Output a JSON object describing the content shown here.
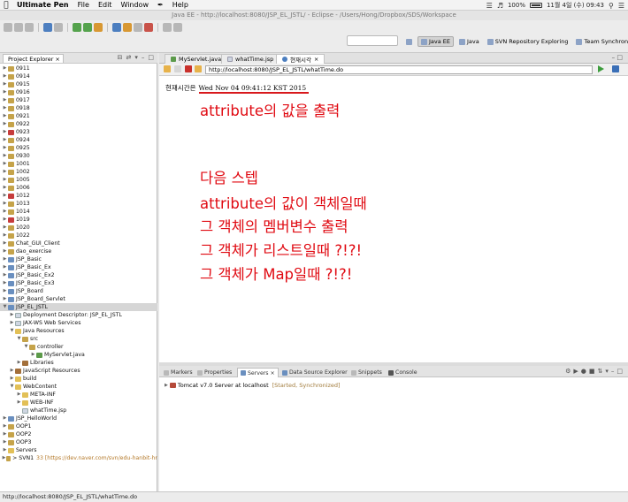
{
  "menubar": {
    "app": "Ultimate Pen",
    "items": [
      "File",
      "Edit",
      "Window",
      "Help"
    ],
    "battery": "100%",
    "datetime": "11월 4일 (수) 09:43"
  },
  "window": {
    "title": "Java EE - http://localhost:8080/JSP_EL_JSTL/ - Eclipse - /Users/Hong/Dropbox/SDS/Workspace"
  },
  "perspectives": [
    "Java EE",
    "Java",
    "SVN Repository Exploring",
    "Team Synchronizing"
  ],
  "explorer": {
    "title": "Project Explorer",
    "items": [
      {
        "label": "0911",
        "depth": 0,
        "icon": "pkg"
      },
      {
        "label": "0914",
        "depth": 0,
        "icon": "pkg"
      },
      {
        "label": "0915",
        "depth": 0,
        "icon": "pkg"
      },
      {
        "label": "0916",
        "depth": 0,
        "icon": "pkg"
      },
      {
        "label": "0917",
        "depth": 0,
        "icon": "pkg"
      },
      {
        "label": "0918",
        "depth": 0,
        "icon": "pkg"
      },
      {
        "label": "0921",
        "depth": 0,
        "icon": "pkg"
      },
      {
        "label": "0922",
        "depth": 0,
        "icon": "pkg"
      },
      {
        "label": "0923",
        "depth": 0,
        "icon": "err"
      },
      {
        "label": "0924",
        "depth": 0,
        "icon": "pkg"
      },
      {
        "label": "0925",
        "depth": 0,
        "icon": "pkg"
      },
      {
        "label": "0930",
        "depth": 0,
        "icon": "pkg"
      },
      {
        "label": "1001",
        "depth": 0,
        "icon": "pkg"
      },
      {
        "label": "1002",
        "depth": 0,
        "icon": "pkg"
      },
      {
        "label": "1005",
        "depth": 0,
        "icon": "pkg"
      },
      {
        "label": "1006",
        "depth": 0,
        "icon": "pkg"
      },
      {
        "label": "1012",
        "depth": 0,
        "icon": "err"
      },
      {
        "label": "1013",
        "depth": 0,
        "icon": "pkg"
      },
      {
        "label": "1014",
        "depth": 0,
        "icon": "pkg"
      },
      {
        "label": "1019",
        "depth": 0,
        "icon": "err"
      },
      {
        "label": "1020",
        "depth": 0,
        "icon": "pkg"
      },
      {
        "label": "1022",
        "depth": 0,
        "icon": "pkg"
      },
      {
        "label": "Chat_GUI_Client",
        "depth": 0,
        "icon": "pkg"
      },
      {
        "label": "dao_exercise",
        "depth": 0,
        "icon": "pkg"
      },
      {
        "label": "JSP_Basic",
        "depth": 0,
        "icon": "proj"
      },
      {
        "label": "JSP_Basic_Ex",
        "depth": 0,
        "icon": "proj"
      },
      {
        "label": "JSP_Basic_Ex2",
        "depth": 0,
        "icon": "proj"
      },
      {
        "label": "JSP_Basic_Ex3",
        "depth": 0,
        "icon": "proj"
      },
      {
        "label": "JSP_Board",
        "depth": 0,
        "icon": "proj"
      },
      {
        "label": "JSP_Board_Servlet",
        "depth": 0,
        "icon": "proj"
      },
      {
        "label": "JSP_EL_JSTL",
        "depth": 0,
        "icon": "proj",
        "open": true,
        "selected": true
      },
      {
        "label": "Deployment Descriptor: JSP_EL_JSTL",
        "depth": 1,
        "icon": "file"
      },
      {
        "label": "JAX-WS Web Services",
        "depth": 1,
        "icon": "file"
      },
      {
        "label": "Java Resources",
        "depth": 1,
        "icon": "folder",
        "open": true
      },
      {
        "label": "src",
        "depth": 2,
        "icon": "pkg",
        "open": true
      },
      {
        "label": "controller",
        "depth": 3,
        "icon": "pkg",
        "open": true
      },
      {
        "label": "MyServlet.java",
        "depth": 4,
        "icon": "java"
      },
      {
        "label": "Libraries",
        "depth": 2,
        "icon": "lib"
      },
      {
        "label": "JavaScript Resources",
        "depth": 1,
        "icon": "lib"
      },
      {
        "label": "build",
        "depth": 1,
        "icon": "folder"
      },
      {
        "label": "WebContent",
        "depth": 1,
        "icon": "folder",
        "open": true
      },
      {
        "label": "META-INF",
        "depth": 2,
        "icon": "folder"
      },
      {
        "label": "WEB-INF",
        "depth": 2,
        "icon": "folder"
      },
      {
        "label": "whatTime.jsp",
        "depth": 2,
        "icon": "file",
        "leaf": true
      },
      {
        "label": "JSP_HelloWorld",
        "depth": 0,
        "icon": "proj"
      },
      {
        "label": "OOP1",
        "depth": 0,
        "icon": "pkg"
      },
      {
        "label": "OOP2",
        "depth": 0,
        "icon": "pkg"
      },
      {
        "label": "OOP3",
        "depth": 0,
        "icon": "pkg"
      },
      {
        "label": "Servers",
        "depth": 0,
        "icon": "folder"
      },
      {
        "label": "> SVN1",
        "depth": 0,
        "icon": "pkg",
        "suffix": "33 [https://dev.naver.com/svn/edu-hanbit-hr"
      }
    ]
  },
  "editor": {
    "tabs": [
      "MyServlet.java",
      "whatTime.jsp",
      "현재시각"
    ],
    "url": "http://localhost:8080/JSP_EL_JSTL/whatTime.do",
    "page_label": "현재시간은",
    "page_time": "Wed Nov 04 09:41:12 KST 2015"
  },
  "notes": [
    "attribute의 값을 출력",
    "다음 스텝",
    "attribute의 값이 객체일때",
    "그 객체의 멤버변수 출력",
    "그 객체가 리스트일때 ?!?!",
    "그 객체가 Map일때 ?!?!"
  ],
  "bottom": {
    "tabs": [
      "Markers",
      "Properties",
      "Servers",
      "Data Source Explorer",
      "Snippets",
      "Console"
    ],
    "active_tab": "Servers",
    "server_name": "Tomcat v7.0 Server at localhost",
    "server_state": "[Started, Synchronized]"
  },
  "statusbar": {
    "text": "http://localhost:8080/JSP_EL_JSTL/whatTime.do"
  },
  "colors": {
    "annotation_red": "#e00a12",
    "selection": "#d6d6d6"
  }
}
